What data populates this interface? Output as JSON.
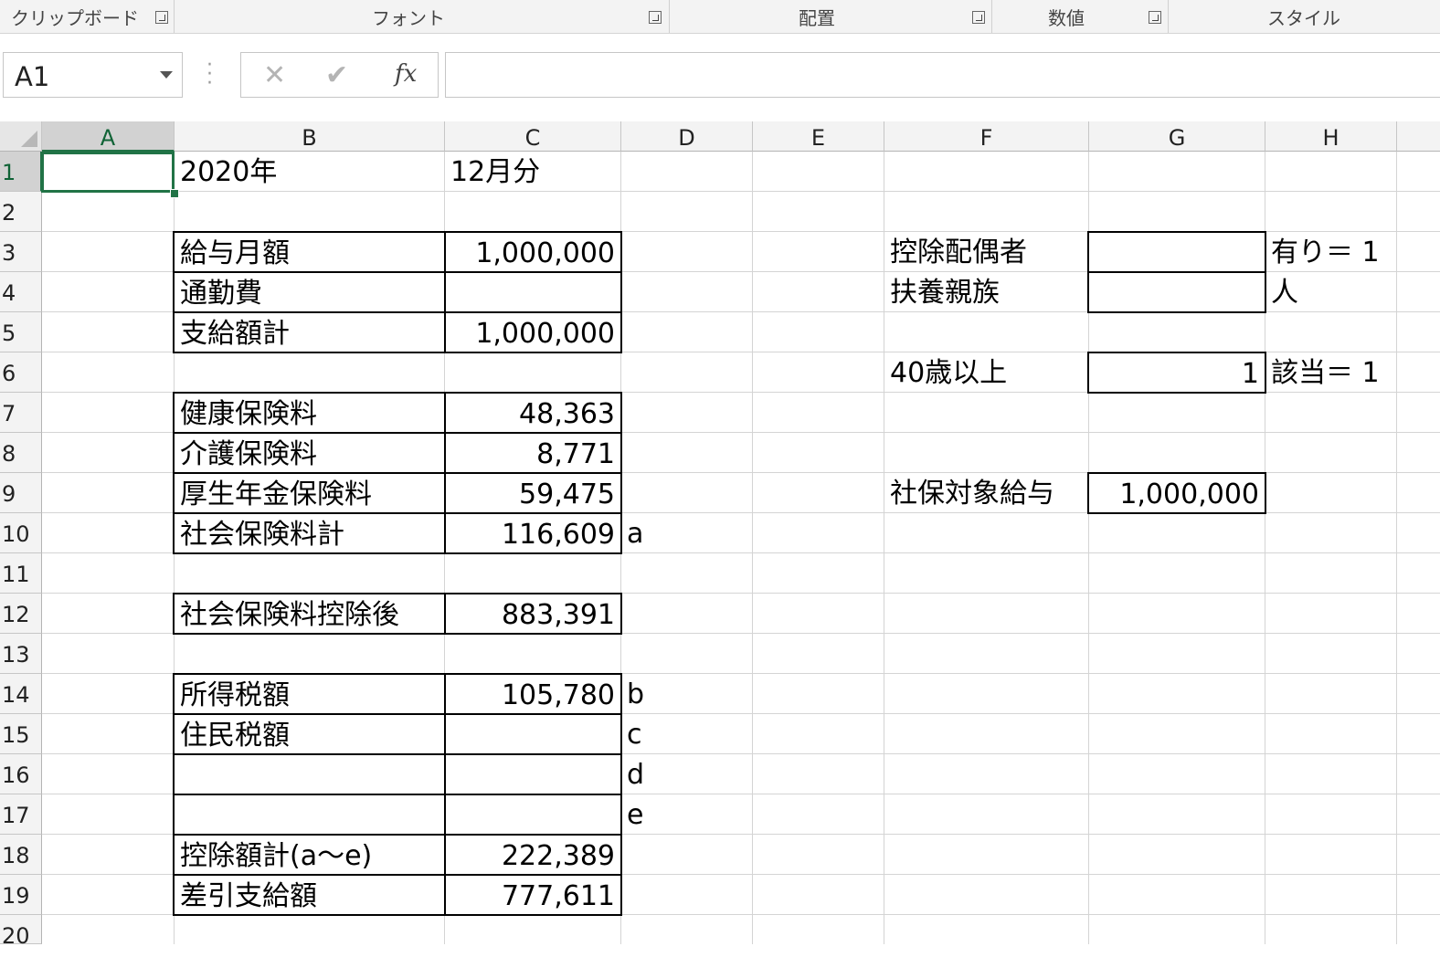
{
  "ribbon": {
    "groups": [
      {
        "label": "クリップボード"
      },
      {
        "label": "フォント"
      },
      {
        "label": "配置"
      },
      {
        "label": "数値"
      },
      {
        "label": "スタイル"
      }
    ]
  },
  "formula_bar": {
    "name_box": "A1",
    "cancel_symbol": "✕",
    "enter_symbol": "✔",
    "fx_label": "fx",
    "formula": ""
  },
  "columns": [
    "A",
    "B",
    "C",
    "D",
    "E",
    "F",
    "G",
    "H"
  ],
  "rows": [
    "1",
    "2",
    "3",
    "4",
    "5",
    "6",
    "7",
    "8",
    "9",
    "10",
    "11",
    "12",
    "13",
    "14",
    "15",
    "16",
    "17",
    "18",
    "19",
    "20"
  ],
  "selected_cell": "A1",
  "cells": {
    "B1": "2020年",
    "C1": "12月分",
    "B3": "給与月額",
    "C3": "1,000,000",
    "B4": "通勤費",
    "C4": "",
    "B5": "支給額計",
    "C5": "1,000,000",
    "B7": "健康保険料",
    "C7": "48,363",
    "B8": "介護保険料",
    "C8": "8,771",
    "B9": "厚生年金保険料",
    "C9": "59,475",
    "B10": "社会保険料計",
    "C10": "116,609",
    "D10": "a",
    "B12": "社会保険料控除後",
    "C12": "883,391",
    "B14": "所得税額",
    "C14": "105,780",
    "D14": "b",
    "B15": "住民税額",
    "C15": "",
    "D15": "c",
    "B16": "",
    "C16": "",
    "D16": "d",
    "B17": "",
    "C17": "",
    "D17": "e",
    "B18": "控除額計(a～e)",
    "C18": "222,389",
    "B19": "差引支給額",
    "C19": "777,611",
    "F3": "控除配偶者",
    "G3": "",
    "H3": "有り＝ 1",
    "F4": "扶養親族",
    "G4": "",
    "H4": "人",
    "F6": "40歳以上",
    "G6": "1",
    "H6": "該当＝ 1",
    "F9": "社保対象給与",
    "G9": "1,000,000"
  },
  "colors": {
    "accent": "#217346",
    "gridline": "#d4d4d4",
    "header_bg": "#f3f3f3"
  }
}
